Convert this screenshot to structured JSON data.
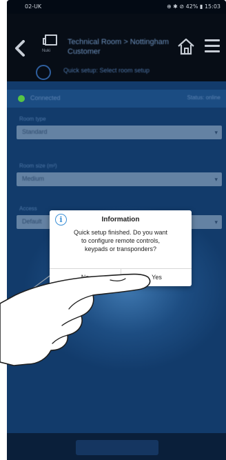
{
  "status_bar": {
    "carrier": "02-UK",
    "right": "⊕ ✱ ⊘ 42% ▮ 15:03"
  },
  "header": {
    "device_label": "Nuki",
    "title": "Technical Room > Nottingham Customer",
    "subtitle": "Quick setup: Select room setup",
    "icons": [
      "back-arrow-icon",
      "device-icon",
      "home-icon",
      "menu-icon",
      "quick-setup-icon"
    ]
  },
  "section": {
    "title": "Connected",
    "right_text": "Status: online"
  },
  "form": {
    "fields": [
      {
        "label": "Room type",
        "value": "Standard"
      },
      {
        "label": "Room size (m²)",
        "value": "Medium"
      },
      {
        "label": "Access",
        "value": "Default"
      }
    ]
  },
  "dialog": {
    "title": "Information",
    "message_line1": "Quick setup finished. Do you want",
    "message_line2": "to configure remote controls,",
    "message_line3": "keypads or transponders?",
    "no_label": "No",
    "yes_label": "Yes",
    "icon": "info-icon"
  },
  "colors": {
    "background": "#0d2c52",
    "header": "#070d16",
    "accent_blue": "#3a8fd6",
    "status_green": "#57c545",
    "dialog_bg": "#ffffff"
  }
}
